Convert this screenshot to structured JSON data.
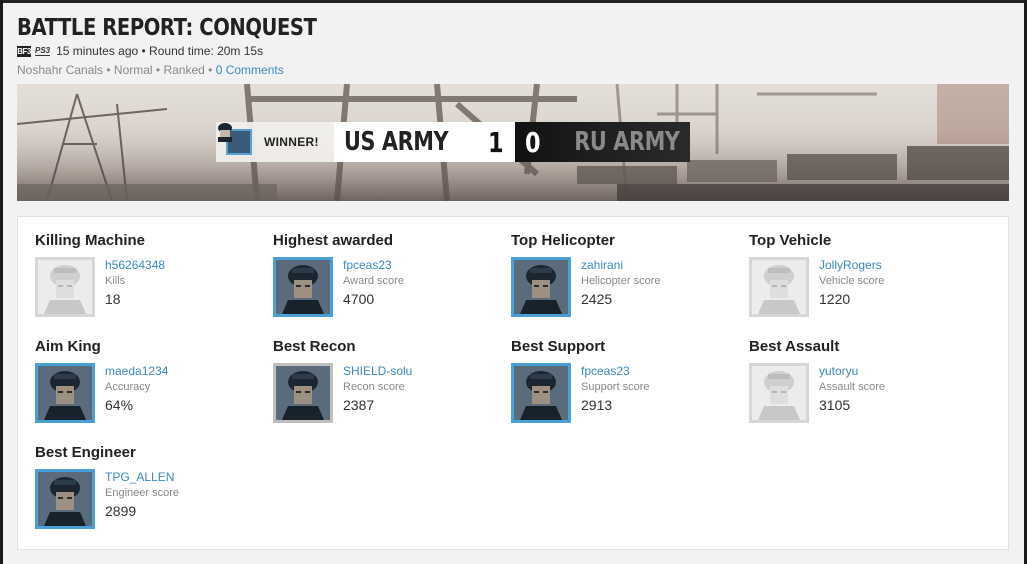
{
  "header": {
    "title": "BATTLE REPORT: CONQUEST",
    "platform_icon_text": "BF3",
    "platform_label": "PS3",
    "time_info": "15 minutes ago • Round time: 20m 15s",
    "map": "Noshahr Canals",
    "mode_info": " • Normal • Ranked • ",
    "comments_link": "0 Comments"
  },
  "scoreboard": {
    "winner_label": "WINNER!",
    "team1_name": "US ARMY",
    "team1_score": "1",
    "team2_score": "0",
    "team2_name": "RU ARMY"
  },
  "awards": [
    {
      "title": "Killing Machine",
      "player": "h56264348",
      "stat_label": "Kills",
      "stat_value": "18",
      "avatar_style": "muted"
    },
    {
      "title": "Highest awarded",
      "player": "fpceas23",
      "stat_label": "Award score",
      "stat_value": "4700",
      "avatar_style": "blue"
    },
    {
      "title": "Top Helicopter",
      "player": "zahirani",
      "stat_label": "Helicopter score",
      "stat_value": "2425",
      "avatar_style": "blue"
    },
    {
      "title": "Top Vehicle",
      "player": "JollyRogers",
      "stat_label": "Vehicle score",
      "stat_value": "1220",
      "avatar_style": "muted"
    },
    {
      "title": "Aim King",
      "player": "maeda1234",
      "stat_label": "Accuracy",
      "stat_value": "64%",
      "avatar_style": "blue"
    },
    {
      "title": "Best Recon",
      "player": "SHIELD-solu",
      "stat_label": "Recon score",
      "stat_value": "2387",
      "avatar_style": "gray"
    },
    {
      "title": "Best Support",
      "player": "fpceas23",
      "stat_label": "Support score",
      "stat_value": "2913",
      "avatar_style": "blue"
    },
    {
      "title": "Best Assault",
      "player": "yutoryu",
      "stat_label": "Assault score",
      "stat_value": "3105",
      "avatar_style": "muted"
    },
    {
      "title": "Best Engineer",
      "player": "TPG_ALLEN",
      "stat_label": "Engineer score",
      "stat_value": "2899",
      "avatar_style": "blue"
    }
  ],
  "colors": {
    "link": "#3b8ab8",
    "avatar_border_active": "#4aa0d8",
    "avatar_border_muted": "#d6d6d6",
    "team2_bar": "#1d1d1d"
  }
}
